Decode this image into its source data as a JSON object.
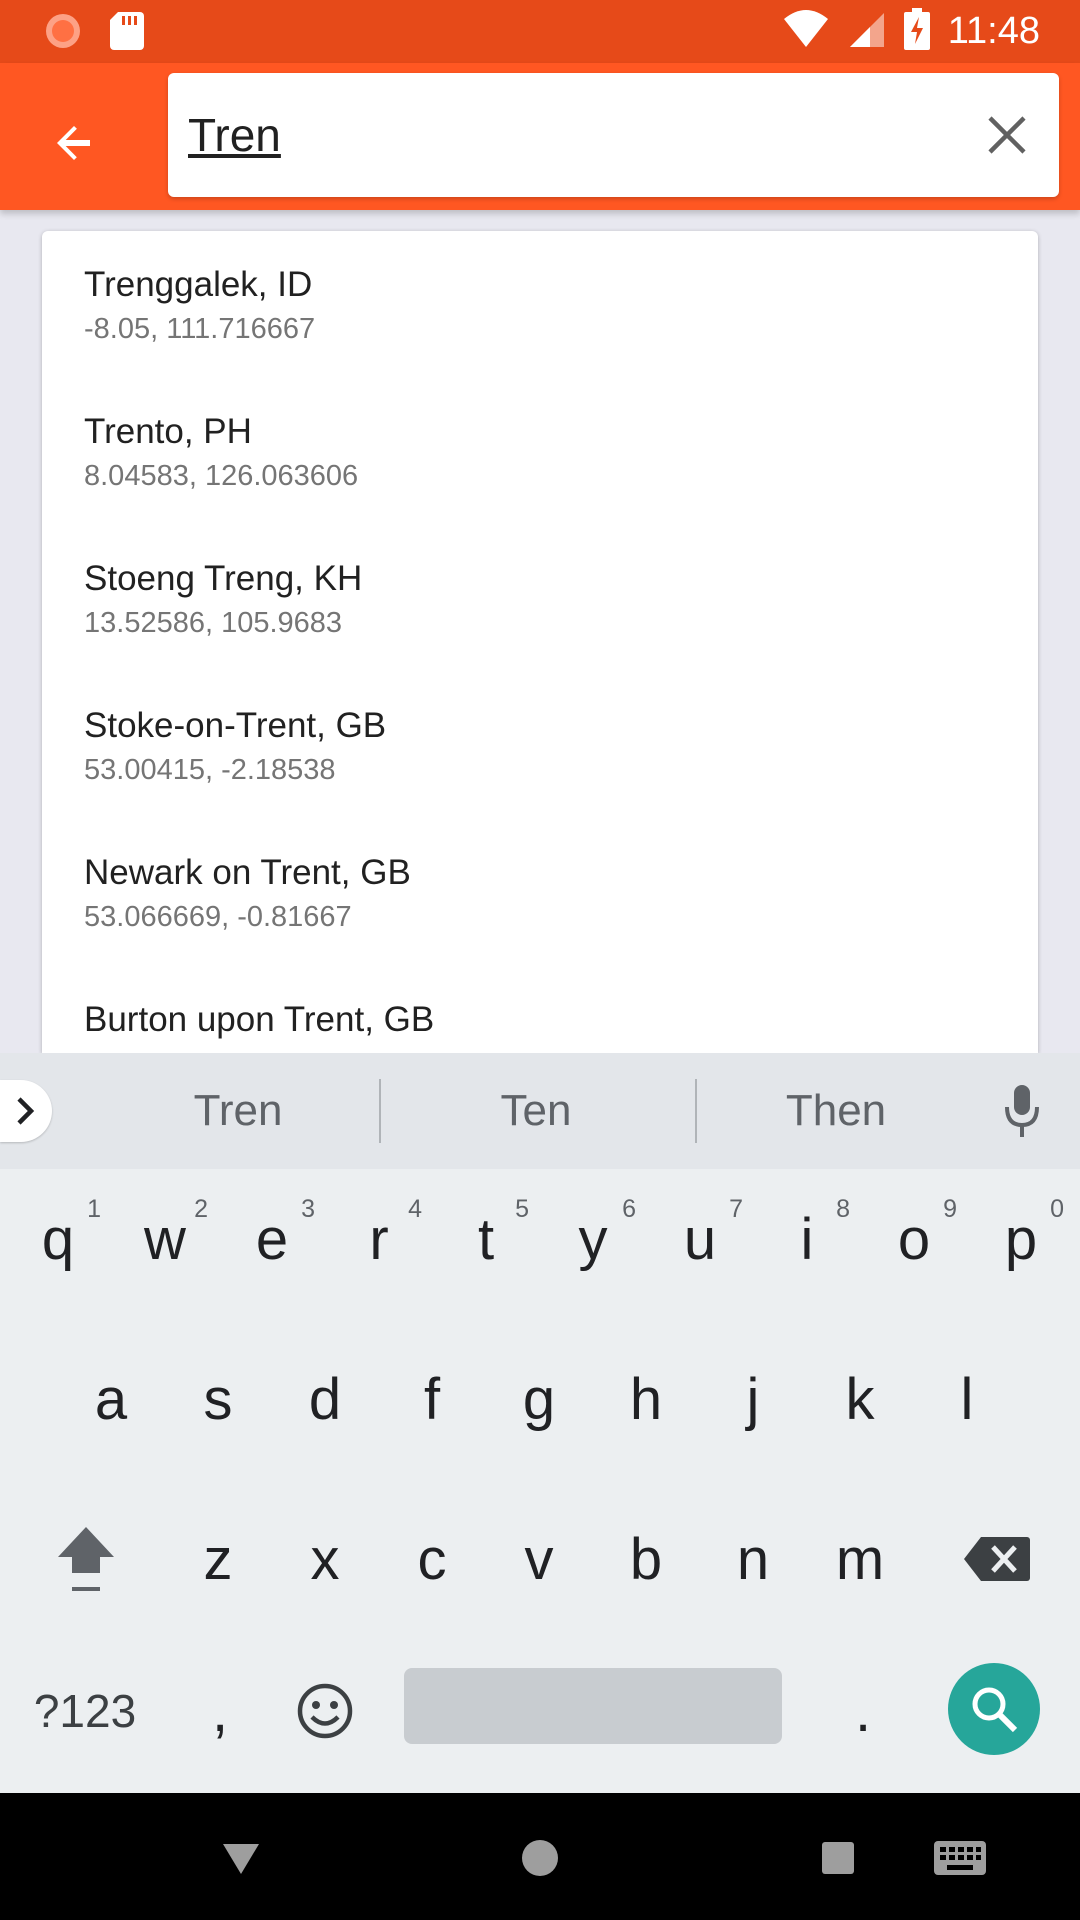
{
  "status_bar": {
    "time": "11:48",
    "icons": [
      "notification-dot-icon",
      "sd-card-icon",
      "wifi-icon",
      "signal-icon",
      "battery-charging-icon"
    ]
  },
  "search": {
    "query": "Tren",
    "back_icon": "arrow-back-icon",
    "clear_icon": "close-icon"
  },
  "suggestions": [
    {
      "title": "Trenggalek, ID",
      "coords": "-8.05, 111.716667"
    },
    {
      "title": "Trento, PH",
      "coords": "8.04583, 126.063606"
    },
    {
      "title": "Stoeng Treng, KH",
      "coords": "13.52586, 105.9683"
    },
    {
      "title": "Stoke-on-Trent, GB",
      "coords": "53.00415, -2.18538"
    },
    {
      "title": "Newark on Trent, GB",
      "coords": "53.066669, -0.81667"
    },
    {
      "title": "Burton upon Trent, GB",
      "coords": ""
    }
  ],
  "keyboard": {
    "suggestions": [
      "Tren",
      "Ten",
      "Then"
    ],
    "row1": [
      {
        "k": "q",
        "h": "1"
      },
      {
        "k": "w",
        "h": "2"
      },
      {
        "k": "e",
        "h": "3"
      },
      {
        "k": "r",
        "h": "4"
      },
      {
        "k": "t",
        "h": "5"
      },
      {
        "k": "y",
        "h": "6"
      },
      {
        "k": "u",
        "h": "7"
      },
      {
        "k": "i",
        "h": "8"
      },
      {
        "k": "o",
        "h": "9"
      },
      {
        "k": "p",
        "h": "0"
      }
    ],
    "row2": [
      "a",
      "s",
      "d",
      "f",
      "g",
      "h",
      "j",
      "k",
      "l"
    ],
    "row3": [
      "z",
      "x",
      "c",
      "v",
      "b",
      "n",
      "m"
    ],
    "symbols_label": "?123",
    "comma": ",",
    "period": ".",
    "accent_color": "#26a69a"
  },
  "colors": {
    "status_bar": "#e64a19",
    "app_bar": "#ff5722"
  }
}
